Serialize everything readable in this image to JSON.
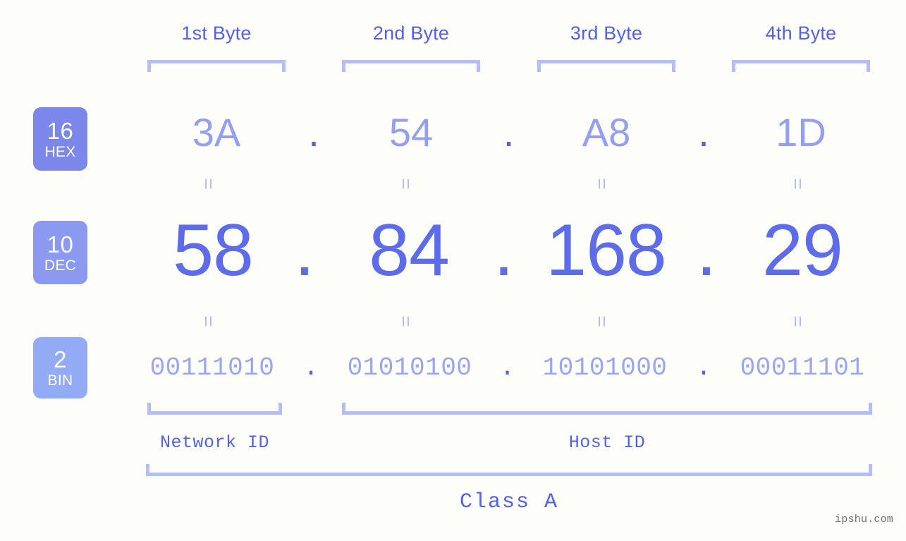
{
  "meta": {
    "watermark": "ipshu.com",
    "background_color": "#fdfdfa",
    "accent_color": "#5161e8",
    "light_accent_color": "#b4bdfb"
  },
  "byte_headers": [
    {
      "label": "1st Byte"
    },
    {
      "label": "2nd Byte"
    },
    {
      "label": "3rd Byte"
    },
    {
      "label": "4th Byte"
    }
  ],
  "bases": [
    {
      "number": "16",
      "name": "HEX",
      "color": "#7b87ea"
    },
    {
      "number": "10",
      "name": "DEC",
      "color": "#8b9af0"
    },
    {
      "number": "2",
      "name": "BIN",
      "color": "#93aaf5"
    }
  ],
  "separator": ".",
  "equals_symbol": "=",
  "rows": {
    "hex": {
      "values": [
        "3A",
        "54",
        "A8",
        "1D"
      ]
    },
    "dec": {
      "values": [
        "58",
        "84",
        "168",
        "29"
      ]
    },
    "bin": {
      "values": [
        "00111010",
        "01010100",
        "10101000",
        "00011101"
      ]
    }
  },
  "segments": {
    "network_id": "Network ID",
    "host_id": "Host ID",
    "class": "Class A"
  }
}
